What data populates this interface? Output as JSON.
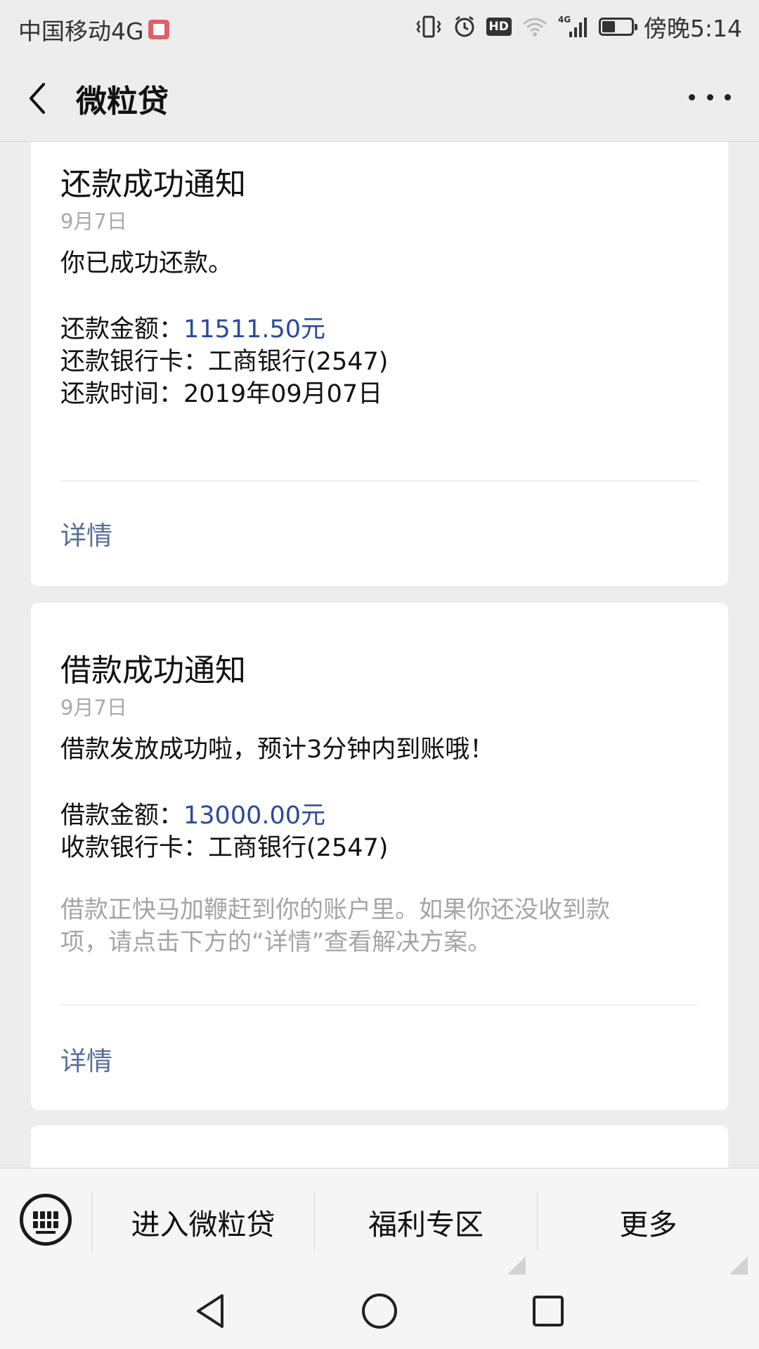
{
  "status_bar": {
    "carrier": "中国移动4G",
    "time": "傍晚5:14",
    "hd": "HD",
    "network": "4G"
  },
  "nav": {
    "title": "微粒贷"
  },
  "messages": [
    {
      "title": "还款成功通知",
      "date": "9月7日",
      "intro": "你已成功还款。",
      "fields": [
        {
          "label": "还款金额：",
          "value": "11511.50元",
          "highlight": true
        },
        {
          "label": "还款银行卡：",
          "value": "工商银行(2547)",
          "highlight": false
        },
        {
          "label": "还款时间：",
          "value": "2019年09月07日",
          "highlight": false
        }
      ],
      "detail_link": "详情"
    },
    {
      "title": "借款成功通知",
      "date": "9月7日",
      "intro": "借款发放成功啦，预计3分钟内到账哦！",
      "fields": [
        {
          "label": "借款金额：",
          "value": "13000.00元",
          "highlight": true
        },
        {
          "label": "收款银行卡：",
          "value": "工商银行(2547)",
          "highlight": false
        }
      ],
      "note_line1": "借款正快马加鞭赶到你的账户里。如果你还没收到款",
      "note_line2": "项，请点击下方的“详情”查看解决方案。",
      "detail_link": "详情"
    }
  ],
  "bottom_menu": {
    "items": [
      "进入微粒贷",
      "福利专区",
      "更多"
    ]
  },
  "colors": {
    "accent": "#2a4a9f",
    "link": "#566f99",
    "background": "#ededed"
  },
  "icons": [
    "back-arrow-icon",
    "more-dots-icon",
    "keyboard-icon",
    "vibrate-icon",
    "alarm-icon",
    "wifi-icon",
    "signal-icon",
    "battery-icon",
    "nav-back-icon",
    "nav-home-icon",
    "nav-recents-icon"
  ]
}
